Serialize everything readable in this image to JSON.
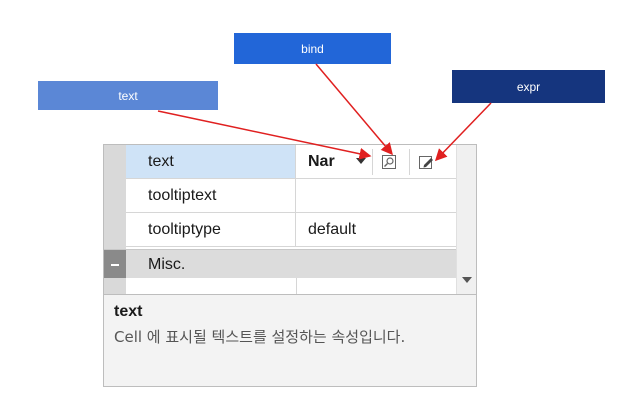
{
  "annotations": {
    "text_label": "text",
    "bind_label": "bind",
    "expr_label": "expr",
    "colors": {
      "text": "#5B87D6",
      "bind": "#2266D8",
      "expr": "#15357E",
      "arrow": "#E02020"
    }
  },
  "property_grid": {
    "rows": [
      {
        "name": "text",
        "value": "Nar",
        "selected": true,
        "has_dropdown": true,
        "buttons": [
          "bind-icon",
          "expr-edit-icon"
        ]
      },
      {
        "name": "tooltiptext",
        "value": ""
      },
      {
        "name": "tooltiptype",
        "value": "default"
      }
    ],
    "category": {
      "label": "Misc.",
      "state": "expanded"
    }
  },
  "description": {
    "title": "text",
    "body": "Cell 에 표시될 텍스트를 설정하는 속성입니다."
  }
}
